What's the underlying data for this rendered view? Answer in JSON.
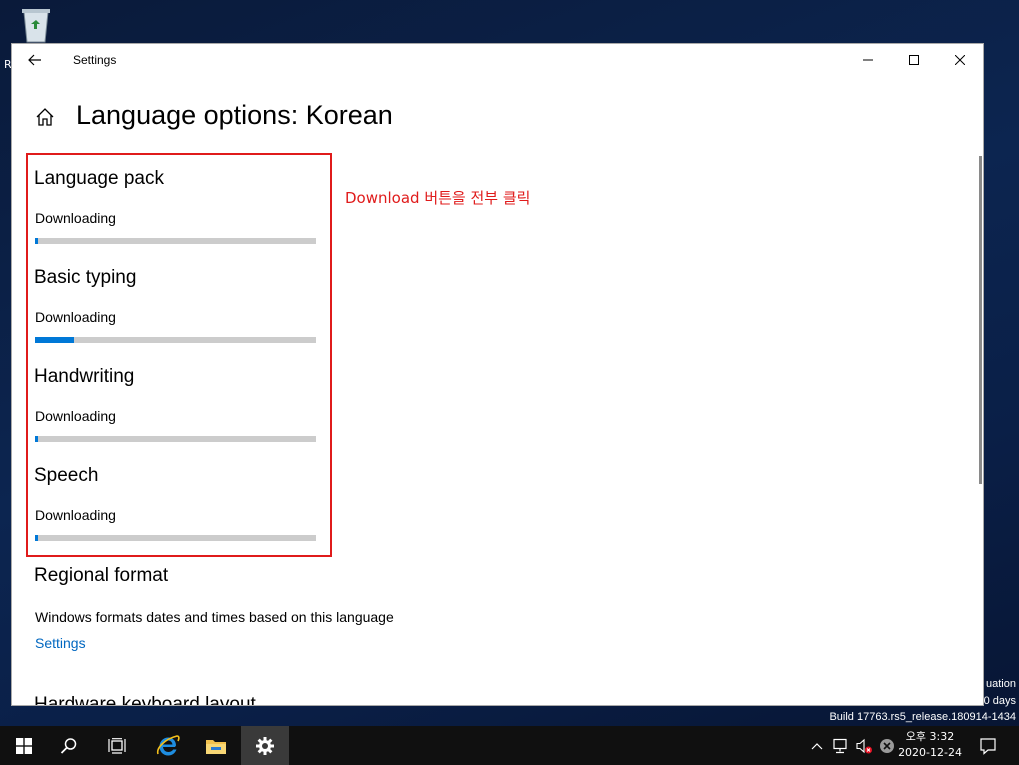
{
  "desktop": {
    "recycle_label": "R",
    "watermark": {
      "line1": "uation",
      "line2": "0 days",
      "build": "Build 17763.rs5_release.180914-1434"
    }
  },
  "window": {
    "title": "Settings"
  },
  "page": {
    "title": "Language options: Korean",
    "annotation": "Download 버튼을 전부 클릭",
    "annotation_color": "#e01b1b",
    "sections": [
      {
        "heading": "Language pack",
        "status": "Downloading",
        "progress": 0.01
      },
      {
        "heading": "Basic typing",
        "status": "Downloading",
        "progress": 0.14
      },
      {
        "heading": "Handwriting",
        "status": "Downloading",
        "progress": 0.01
      },
      {
        "heading": "Speech",
        "status": "Downloading",
        "progress": 0.01
      }
    ],
    "regional": {
      "heading": "Regional format",
      "description": "Windows formats dates and times based on this language",
      "link": "Settings"
    },
    "hardware_heading": "Hardware keyboard layout"
  },
  "taskbar": {
    "items": [
      "start-icon",
      "search-icon",
      "task-view-icon",
      "internet-explorer-icon",
      "file-explorer-icon",
      "settings-icon"
    ],
    "clock": {
      "time": "오후 3:32",
      "date": "2020-12-24"
    }
  },
  "colors": {
    "accent": "#0078d7",
    "link": "#0067c0",
    "highlight": "#e01b1b"
  }
}
